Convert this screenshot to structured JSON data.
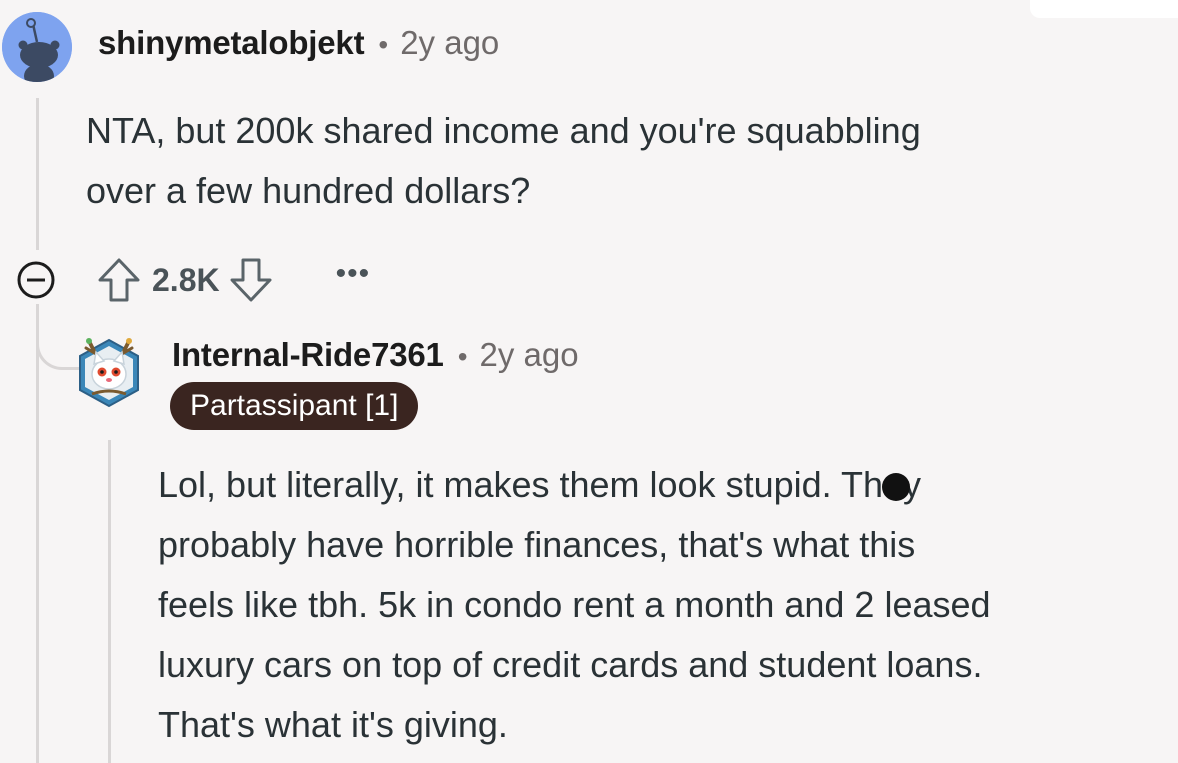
{
  "comment": {
    "username": "shinymetalobjekt",
    "time": "2y ago",
    "body_lines": [
      "NTA, but 200k shared income and you're squabbling",
      "over a few hundred dollars?"
    ],
    "score": "2.8K",
    "more_label": "•••",
    "avatar_color": "#7ea3ef"
  },
  "reply": {
    "username": "Internal-Ride7361",
    "time": "2y ago",
    "flair": "Partassipant [1]",
    "flair_color": "#3a2520",
    "body_lines": [
      "Lol, but literally, it makes them look stupid. They",
      "probably have horrible finances, that's what this",
      "feels like tbh. 5k in condo rent a month and 2 leased",
      "luxury cars on top of credit cards and student loans.",
      "That's what it's giving."
    ]
  },
  "separator": "•",
  "icons": [
    "snoo-avatar-icon",
    "cat-avatar-icon",
    "collapse-minus-icon",
    "upvote-icon",
    "downvote-icon",
    "more-options-icon"
  ]
}
